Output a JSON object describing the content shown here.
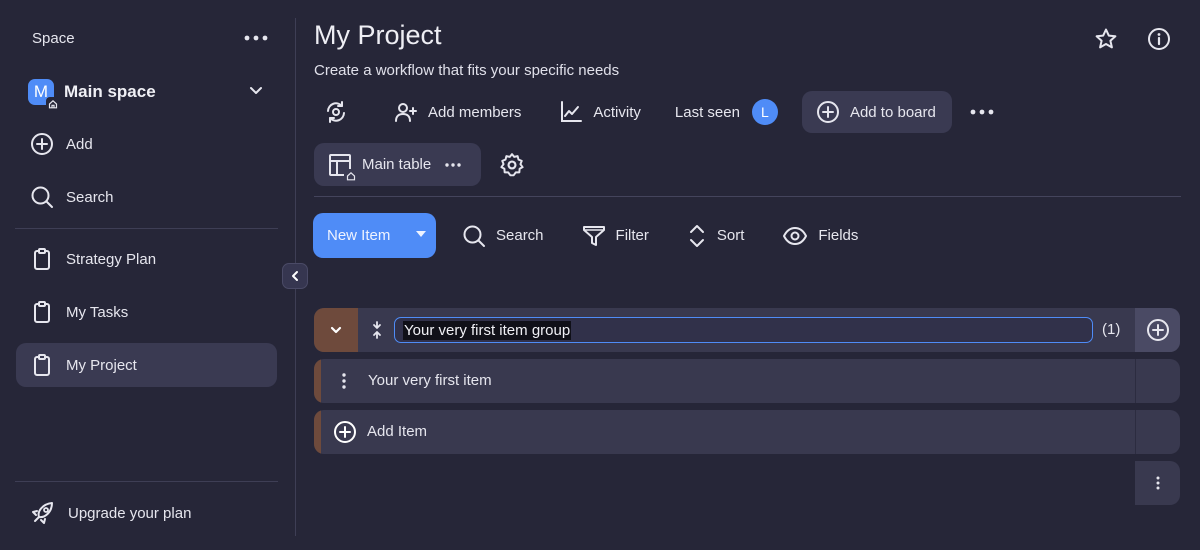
{
  "sidebar": {
    "header": "Space",
    "space": {
      "initial": "M",
      "name": "Main space"
    },
    "actions": [
      {
        "label": "Add",
        "icon": "plus-circle-icon"
      },
      {
        "label": "Search",
        "icon": "search-icon"
      }
    ],
    "boards": [
      {
        "label": "Strategy Plan",
        "icon": "clipboard-icon",
        "active": false
      },
      {
        "label": "My Tasks",
        "icon": "clipboard-icon",
        "active": false
      },
      {
        "label": "My Project",
        "icon": "clipboard-icon",
        "active": true
      }
    ],
    "upgrade": {
      "label": "Upgrade your plan",
      "icon": "rocket-icon"
    }
  },
  "header": {
    "title": "My Project",
    "subtitle": "Create a workflow that fits your specific needs",
    "toolbar": {
      "add_members": "Add members",
      "activity": "Activity",
      "last_seen": "Last seen",
      "last_seen_avatar": "L",
      "add_to_board": "Add to board"
    }
  },
  "view": {
    "tab_label": "Main table"
  },
  "actions": {
    "new_item": "New Item",
    "search": "Search",
    "filter": "Filter",
    "sort": "Sort",
    "fields": "Fields"
  },
  "group": {
    "name": "Your very first item group",
    "count": "(1)",
    "items": [
      {
        "name": "Your very first item"
      }
    ],
    "add_item": "Add Item"
  },
  "colors": {
    "background": "#262638",
    "accent": "#4f8cf7",
    "group_color": "#6e4a3c",
    "surface": "#39394f"
  }
}
